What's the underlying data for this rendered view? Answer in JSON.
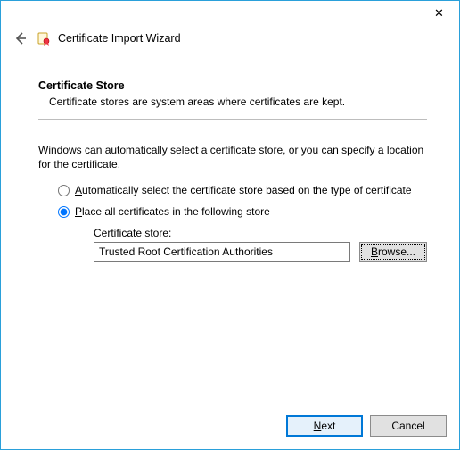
{
  "window": {
    "close_glyph": "✕"
  },
  "header": {
    "title": "Certificate Import Wizard"
  },
  "section": {
    "heading": "Certificate Store",
    "description": "Certificate stores are system areas where certificates are kept."
  },
  "body": {
    "intro": "Windows can automatically select a certificate store, or you can specify a location for the certificate."
  },
  "radios": {
    "auto": {
      "prefix": "A",
      "rest": "utomatically select the certificate store based on the type of certificate",
      "checked": false
    },
    "place": {
      "prefix": "P",
      "rest": "lace all certificates in the following store",
      "checked": true
    }
  },
  "store": {
    "label": "Certificate store:",
    "value": "Trusted Root Certification Authorities",
    "browse_prefix": "B",
    "browse_rest": "rowse..."
  },
  "footer": {
    "next_prefix": "N",
    "next_rest": "ext",
    "cancel": "Cancel"
  }
}
